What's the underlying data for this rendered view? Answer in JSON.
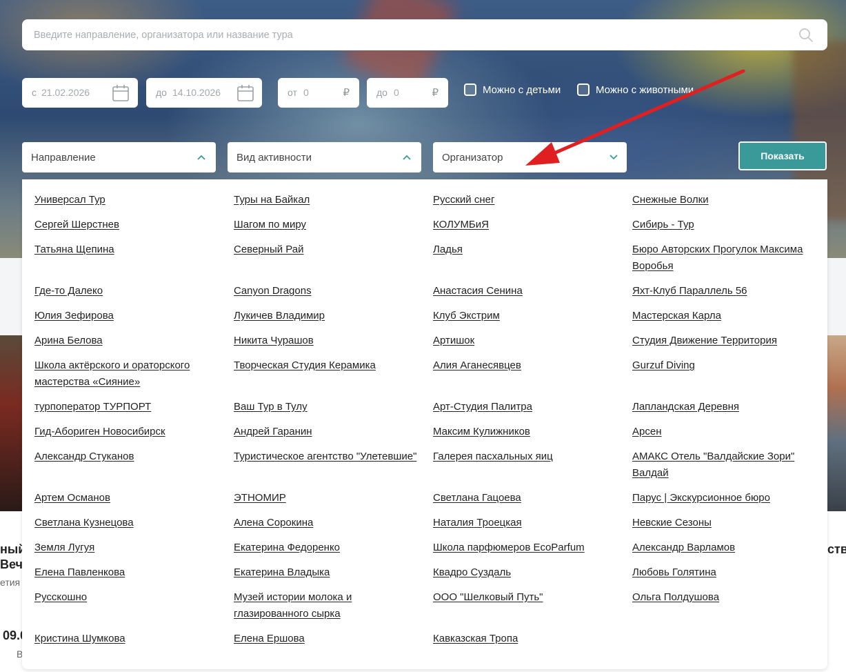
{
  "search": {
    "placeholder": "Введите направление, организатора или название тура"
  },
  "dates": {
    "from_prefix": "с",
    "from_value": "21.02.2026",
    "to_prefix": "до",
    "to_value": "14.10.2026"
  },
  "price": {
    "from_prefix": "от",
    "from_value": "0",
    "to_prefix": "до",
    "to_value": "0",
    "currency": "₽"
  },
  "checkboxes": {
    "kids": "Можно с детьми",
    "pets": "Можно с животными"
  },
  "filters": {
    "direction": "Направление",
    "activity": "Вид активности",
    "organizer": "Организатор",
    "show_button": "Показать"
  },
  "background_fragments": {
    "left_title_1": "ный",
    "left_title_2": "Вече",
    "left_sub": "етия -",
    "left_date": "09.0",
    "left_meta": "В",
    "right_title": "ств"
  },
  "organizers": [
    "Универсал Тур",
    "Туры на Байкал",
    "Русский снег",
    "Снежные Волки",
    "Сергей Шерстнев",
    "Шагом по миру",
    "КОЛУМБиЯ",
    "Сибирь - Тур",
    "Татьяна Щепина",
    "Северный Рай",
    "Ладья",
    "Бюро Авторских Прогулок Максима Воробья",
    "Где-то Далеко",
    "Canyon Dragons",
    "Анастасия Сенина",
    "Яхт-Клуб Параллель 56",
    "Юлия Зефирова",
    "Лукичев Владимир",
    "Клуб Экстрим",
    "Мастерская Карла",
    "Арина Белова",
    "Никита Чурашов",
    "Артишок",
    "Студия Движение Территория",
    "Школа актёрского и ораторского мастерства «Сияние»",
    "Творческая Студия Керамика",
    "Алия Аганесявцев",
    "Gurzuf Diving",
    "турпоператор ТУРПОРТ",
    "Ваш Тур в Тулу",
    "Арт-Студия Палитра",
    "Лапландская Деревня",
    "Гид-Абориген Новосибирск",
    "Андрей Гаранин",
    "Максим Кулижников",
    "Арсен",
    "Александр Стуканов",
    "Туристическое агентство \"Улетевшие\"",
    "Галерея пасхальных яиц",
    "АМАКС Отель \"Валдайские Зори\" Валдай",
    "Артем Османов",
    "ЭТНОМИР",
    "Светлана Гацоева",
    "Парус | Экскурсионное бюро",
    "Светлана Кузнецова",
    "Алена Сорокина",
    "Наталия Троецкая",
    "Невские Сезоны",
    "Земля Лугуя",
    "Екатерина Федоренко",
    "Школа парфюмеров EcoParfum",
    "Александр Варламов",
    "Елена Павленкова",
    "Екатерина Владыка",
    "Квадро Суздаль",
    "Любовь Голятина",
    "Русскошно",
    "Музей истории молока и глазированного сырка",
    "ООО \"Шелковый Путь\"",
    "Ольга Полдушова",
    "Кристина Шумкова",
    "Елена Ершова",
    "Кавказская Тропа",
    ""
  ],
  "colors": {
    "accent": "#3a9a9a",
    "arrow": "#e02020"
  }
}
